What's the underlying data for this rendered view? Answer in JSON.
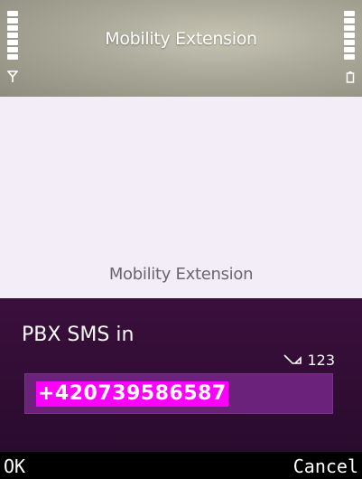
{
  "header": {
    "title": "Mobility Extension",
    "signal_icon": "antenna-icon",
    "battery_icon": "battery-icon"
  },
  "content": {
    "label": "Mobility Extension"
  },
  "dialog": {
    "prompt": "PBX SMS in",
    "input_mode": "123",
    "input_mode_icon": "pen-icon",
    "value": "+420739586587"
  },
  "softkeys": {
    "left": "OK",
    "right": "Cancel"
  },
  "colors": {
    "content_bg": "#f2edf6",
    "dialog_bg": "#2a0b2e",
    "input_bg": "#6a227a",
    "highlight": "#ff00ff"
  }
}
